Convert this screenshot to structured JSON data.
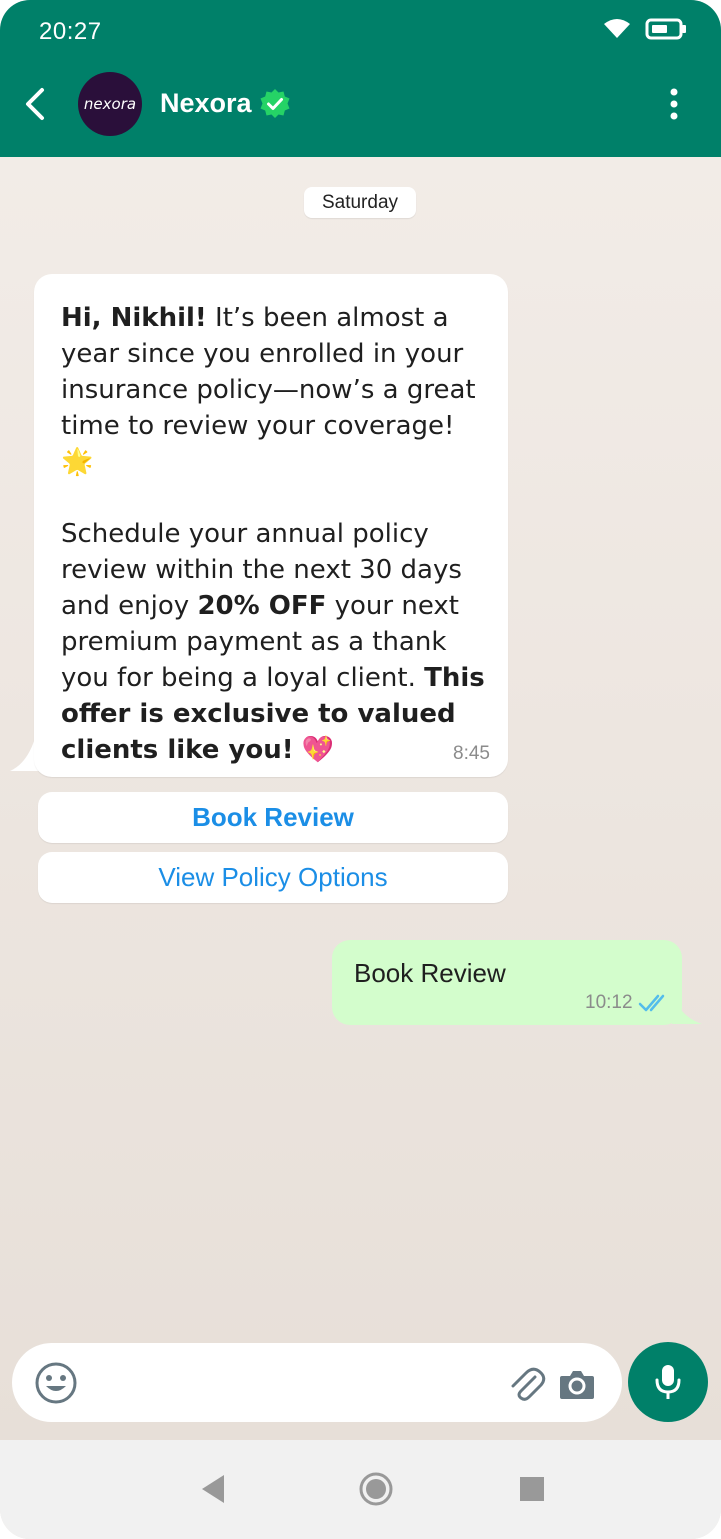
{
  "status_bar": {
    "time": "20:27",
    "icons": [
      "wifi-icon",
      "battery-icon"
    ]
  },
  "header": {
    "contact_name": "Nexora",
    "avatar_text": "nexora",
    "verified": true,
    "icons": [
      "back-arrow-icon",
      "verified-check-icon",
      "more-vertical-icon"
    ]
  },
  "chat": {
    "date_chip": "Saturday",
    "incoming": {
      "greeting": "Hi, Nikhil!",
      "text1": " It’s been almost a year since you enrolled in your insurance policy—now’s a great time to review your coverage! ",
      "emoji1": "🌟",
      "text2": "Schedule your annual policy review within the next 30 days and enjoy ",
      "offer": "20% OFF",
      "text3": " your next premium payment as a thank you for being a loyal client. ",
      "exclusive": "This offer is exclusive to valued clients like you!",
      "emoji2": "💖",
      "time": "8:45"
    },
    "quick_replies": [
      {
        "label": "Book Review"
      },
      {
        "label": "View Policy Options"
      }
    ],
    "outgoing": {
      "text": "Book Review",
      "time": "10:12",
      "status": "read"
    }
  },
  "composer": {
    "icons": [
      "emoji-icon",
      "paperclip-icon",
      "camera-icon",
      "mic-icon"
    ]
  },
  "colors": {
    "header": "#008069",
    "outgoing_bubble": "#d3fdcc",
    "quick_reply_text": "#1b8ee6",
    "read_ticks": "#53bdeb"
  },
  "navigation": {
    "icons": [
      "back-triangle-icon",
      "home-circle-icon",
      "recents-square-icon"
    ]
  }
}
